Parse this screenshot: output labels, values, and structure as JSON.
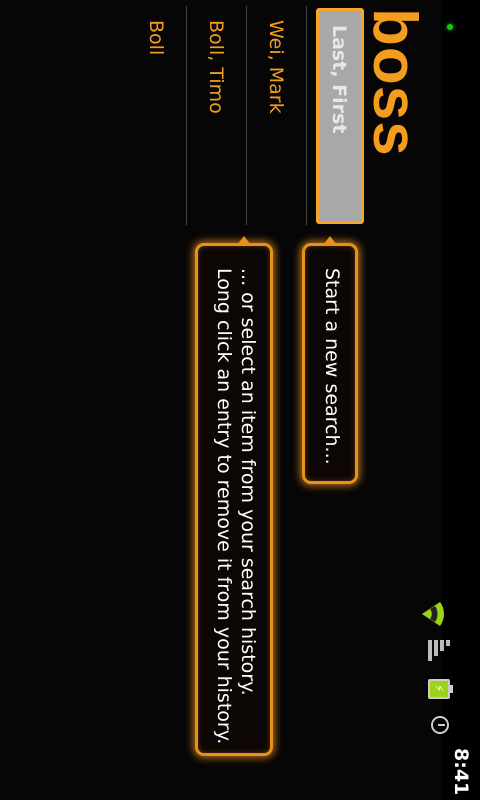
{
  "status_bar": {
    "time": "8:41",
    "icons": [
      "notification-led-icon",
      "wifi-icon",
      "signal-icon",
      "battery-charging-icon",
      "alarm-icon"
    ]
  },
  "app": {
    "logo": "boss",
    "search": {
      "placeholder": "Last, First"
    },
    "history": [
      "Wei, Mark",
      "Boll, Timo",
      "Boll"
    ],
    "hints": {
      "new_search": "Start a new search...",
      "history_line1": "... or select an item from your search history.",
      "history_line2": "Long click an entry to remove it from your history."
    }
  },
  "colors": {
    "accent": "#f39c1e",
    "background": "#060606",
    "search_fill": "#a8a8a8"
  }
}
